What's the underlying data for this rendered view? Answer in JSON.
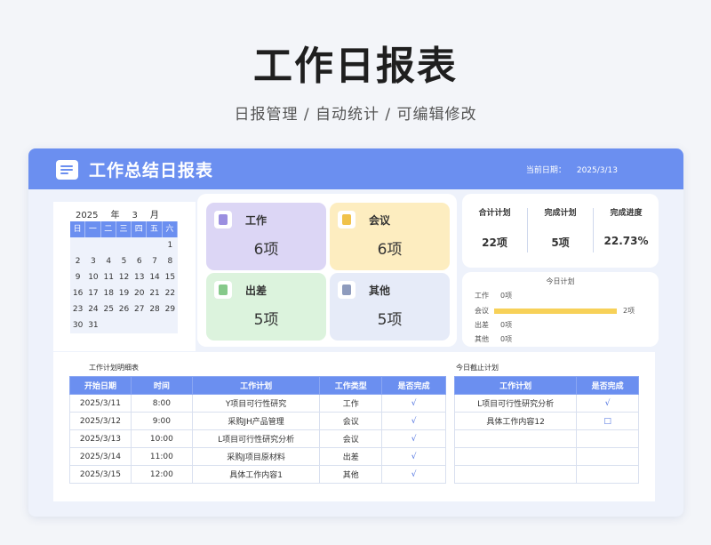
{
  "page": {
    "title": "工作日报表",
    "subtitle": "日报管理 / 自动统计 /  可编辑修改"
  },
  "header": {
    "title": "工作总结日报表",
    "date_label": "当前日期：",
    "date_value": "2025/3/13"
  },
  "calendar": {
    "year": "2025",
    "year_unit": "年",
    "month": "3",
    "month_unit": "月",
    "weekdays": [
      "日",
      "一",
      "二",
      "三",
      "四",
      "五",
      "六"
    ],
    "weeks": [
      [
        "",
        "",
        "",
        "",
        "",
        "",
        "1"
      ],
      [
        "2",
        "3",
        "4",
        "5",
        "6",
        "7",
        "8"
      ],
      [
        "9",
        "10",
        "11",
        "12",
        "13",
        "14",
        "15"
      ],
      [
        "16",
        "17",
        "18",
        "19",
        "20",
        "21",
        "22"
      ],
      [
        "23",
        "24",
        "25",
        "26",
        "27",
        "28",
        "29"
      ],
      [
        "30",
        "31",
        "",
        "",
        "",
        "",
        ""
      ]
    ]
  },
  "categories": [
    {
      "label": "工作",
      "value": "6项",
      "color": "#dcd6f5",
      "icon": "document-icon",
      "icon_color": "#9b8fe0"
    },
    {
      "label": "会议",
      "value": "6项",
      "color": "#fdedc0",
      "icon": "document-icon",
      "icon_color": "#f0c24a"
    },
    {
      "label": "出差",
      "value": "5项",
      "color": "#dcf3dd",
      "icon": "document-icon",
      "icon_color": "#86c98a"
    },
    {
      "label": "其他",
      "value": "5项",
      "color": "#e6ebf8",
      "icon": "document-icon",
      "icon_color": "#8e9bbd"
    }
  ],
  "stats": [
    {
      "label": "合计计划",
      "value": "22项"
    },
    {
      "label": "完成计划",
      "value": "5项"
    },
    {
      "label": "完成进度",
      "value": "22.73%"
    }
  ],
  "today_plan": {
    "title": "今日计划",
    "bars": [
      {
        "label": "工作",
        "value": "0项",
        "count": 0
      },
      {
        "label": "会议",
        "value": "2项",
        "count": 2
      },
      {
        "label": "出差",
        "value": "0项",
        "count": 0
      },
      {
        "label": "其他",
        "value": "0项",
        "count": 0
      }
    ],
    "max": 2
  },
  "detail": {
    "title": "工作计划明细表",
    "headers": [
      "开始日期",
      "时间",
      "工作计划",
      "工作类型",
      "是否完成"
    ],
    "rows": [
      [
        "2025/3/11",
        "8:00",
        "Y项目可行性研究",
        "工作",
        "√"
      ],
      [
        "2025/3/12",
        "9:00",
        "采购JH产品管理",
        "会议",
        "√"
      ],
      [
        "2025/3/13",
        "10:00",
        "L项目可行性研究分析",
        "会议",
        "√"
      ],
      [
        "2025/3/14",
        "11:00",
        "采购J项目原材料",
        "出差",
        "√"
      ],
      [
        "2025/3/15",
        "12:00",
        "具体工作内容1",
        "其他",
        "√"
      ]
    ]
  },
  "due_today": {
    "title": "今日截止计划",
    "headers": [
      "工作计划",
      "是否完成"
    ],
    "rows": [
      [
        "L项目可行性研究分析",
        "√"
      ],
      [
        "具体工作内容12",
        "□"
      ],
      [
        "",
        ""
      ],
      [
        "",
        ""
      ],
      [
        "",
        ""
      ]
    ]
  }
}
